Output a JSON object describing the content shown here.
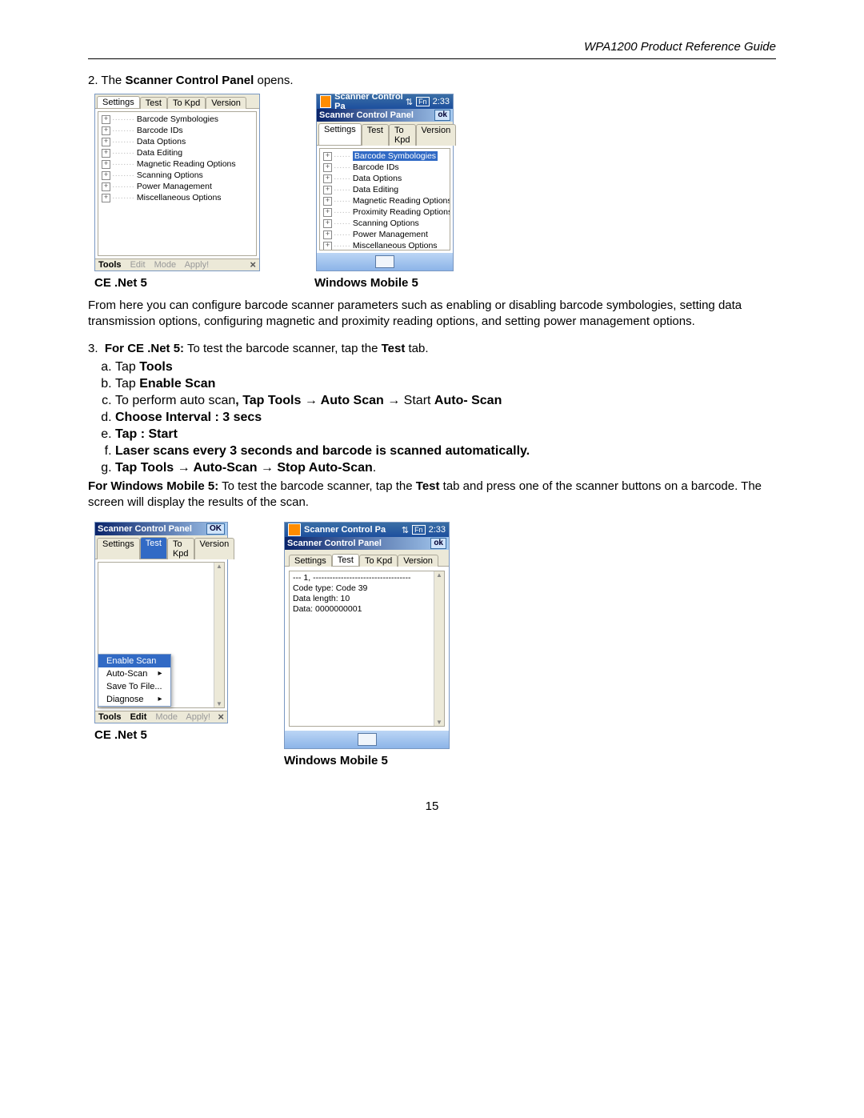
{
  "header": {
    "title": "WPA1200 Product Reference Guide"
  },
  "page_number": "15",
  "step2": {
    "number": "2.",
    "prefix": "The ",
    "bold": "Scanner Control Panel",
    "suffix": " opens."
  },
  "captions": {
    "ce": "CE .Net 5",
    "wm": "Windows Mobile 5"
  },
  "para1": "From here you can configure barcode scanner parameters such as enabling or disabling barcode symbologies, setting data transmission options, configuring magnetic and proximity reading options, and setting power management options.",
  "step3": {
    "number": "3.",
    "bold1": "For CE .Net 5:",
    "mid": " To test the barcode scanner, tap the ",
    "bold2": "Test",
    "suffix": " tab."
  },
  "sub": {
    "a": {
      "pre": "Tap ",
      "b": "Tools"
    },
    "b": {
      "pre": "Tap ",
      "b": "Enable Scan"
    },
    "c": {
      "pre": "To perform auto scan",
      "b1": ", Tap  Tools → Auto Scan → ",
      "mid": "Start ",
      "b2": "Auto- Scan"
    },
    "d": "Choose Interval : 3 secs",
    "e": "Tap : Start",
    "f": "Laser scans every 3 seconds and barcode is scanned automatically.",
    "g": "Tap Tools → Auto-Scan → Stop Auto-Scan"
  },
  "wm_para": {
    "b1": "For Windows Mobile 5:",
    "mid1": "  To test the barcode scanner, tap the ",
    "b2": "Test",
    "mid2": " tab and press one of the scanner buttons on a barcode.  The screen will display the results of the scan."
  },
  "screenshot_ce1": {
    "tabs": [
      "Settings",
      "Test",
      "To Kpd",
      "Version"
    ],
    "activeTab": "Settings",
    "items": [
      "Barcode Symbologies",
      "Barcode IDs",
      "Data Options",
      "Data Editing",
      "Magnetic Reading Options",
      "Scanning Options",
      "Power Management",
      "Miscellaneous Options"
    ],
    "menu": {
      "tools": "Tools",
      "edit": "Edit",
      "mode": "Mode",
      "apply": "Apply!"
    }
  },
  "screenshot_wm1": {
    "statusbar": {
      "title": "Scanner Control Pa",
      "time": "2:33",
      "ind": "Fn"
    },
    "titlebar": {
      "title": "Scanner Control Panel",
      "ok": "ok"
    },
    "tabs": [
      "Settings",
      "Test",
      "To Kpd",
      "Version"
    ],
    "activeTab": "Settings",
    "selected": "Barcode Symbologies",
    "items": [
      "Barcode IDs",
      "Data Options",
      "Data Editing",
      "Magnetic Reading Options",
      "Proximity Reading Options",
      "Scanning Options",
      "Power Management",
      "Miscellaneous Options"
    ]
  },
  "screenshot_ce2": {
    "titlebar": {
      "title": "Scanner Control Panel",
      "ok": "OK"
    },
    "tabs": [
      "Settings",
      "Test",
      "To Kpd",
      "Version"
    ],
    "activeTab": "Test",
    "popup": [
      "Enable Scan",
      "Auto-Scan",
      "Save To File...",
      "Diagnose"
    ],
    "popup_hl": "Enable Scan",
    "menu": {
      "tools": "Tools",
      "edit": "Edit",
      "mode": "Mode",
      "apply": "Apply!"
    }
  },
  "screenshot_wm2": {
    "statusbar": {
      "title": "Scanner Control Pa",
      "time": "2:33",
      "ind": "Fn"
    },
    "titlebar": {
      "title": "Scanner Control Panel",
      "ok": "ok"
    },
    "tabs": [
      "Settings",
      "Test",
      "To Kpd",
      "Version"
    ],
    "activeTab": "Test",
    "lines": [
      "--- 1, -----------------------------------",
      "Code type: Code 39",
      "Data length: 10",
      "Data: 0000000001"
    ]
  }
}
